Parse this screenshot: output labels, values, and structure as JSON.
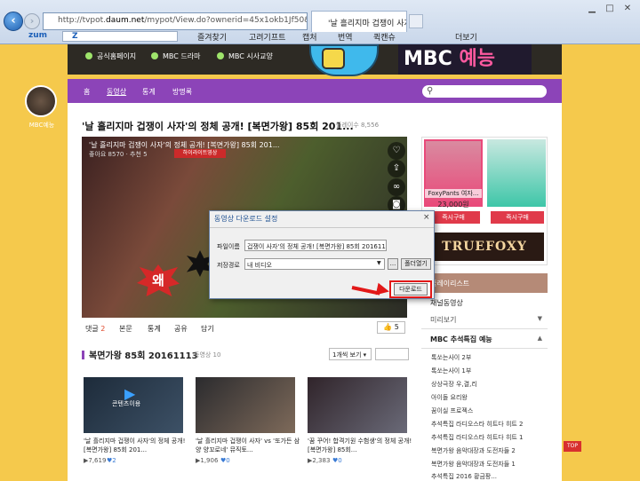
{
  "browser": {
    "address_pre": "http://tvpot.",
    "address_domain": "daum.net",
    "address_post": "/mypot/View.do?ownerid=45x1okb1Jf50&playlistid=6866398",
    "tab_title": "'날 흘리지마 겁쟁이 사자'",
    "toolbar": {
      "zum": "zum",
      "z": "Z",
      "bookmarks": "즐겨찾기",
      "korea_tools": "고려기프트",
      "capture": "캡처",
      "translate": "번역",
      "clean": "퀵캔슈",
      "more": "더보기"
    },
    "window_controls": {
      "min": "▁",
      "max": "□",
      "close": "✕"
    }
  },
  "page": {
    "channel_label": "MBC예능",
    "banner_items": [
      "공식홈페이지",
      "MBC 드라마",
      "MBC 시사교양"
    ],
    "banner_logo_main": "MBC",
    "banner_logo_sub": "예능",
    "nav": [
      "홈",
      "동영상",
      "통계",
      "방명록"
    ],
    "video_title": "'날 흘리지마 겁쟁이 사자'의 정체 공개! [복면가왕] 85회 201...",
    "view_count": "플레이수 8,556",
    "player": {
      "title": "'날 흘리지마 겁쟁이 사자'의 정체 공개! [복면가왕] 85회 201...",
      "meta": "좋아요 8570  ·  추천 5",
      "badge": "하이라이트영상",
      "wow": "왜"
    },
    "video_tabs": {
      "comment": "댓글",
      "comment_count": "2",
      "info": "본문",
      "stats": "통계",
      "share": "공유",
      "add": "담기"
    },
    "like": "👍 5",
    "section_title": "복면가왕 85회 20161113",
    "section_count": "동영상 10",
    "sort": "1개씩 보기 ▾",
    "thumbs": [
      {
        "caption": "'날 흘리지마 겁쟁이 사자'의 정체 공개! [복면가왕] 85회 201...",
        "plays": "▶7,619",
        "likes": "♥2",
        "overlay": "콘텐츠이용"
      },
      {
        "caption": "'날 흘리지마 겁쟁이 사자' vs '또가든 삼양 양꼬로네' 뮤직토...",
        "plays": "▶1,906",
        "likes": "♥0",
        "overlay": ""
      },
      {
        "caption": "'꿈 꾸어! 합격기원 수험생'의 정체 공개! [복면가왕] 85회...",
        "plays": "▶2,383",
        "likes": "♥0",
        "overlay": ""
      }
    ]
  },
  "dialog": {
    "title": "동영상 다운로드 설정",
    "close": "×",
    "filename_label": "파일이름",
    "filename_value": "겁쟁이 사자'의 정체 공개! [복면가왕] 85회 20161113",
    "path_label": "저장경로",
    "path_value": "내 비디오",
    "dots": "...",
    "open_folder": "폴더열기",
    "download": "다운로드"
  },
  "sidebar": {
    "ad_product": "FoxyPants 여자...",
    "ad_price": "23,000원",
    "ad_buy": "즉시구매",
    "ad_brand": "TRUEFOXY",
    "header": "플레이리스트",
    "rows": [
      "채널동영상",
      "미리보기",
      "MBC 추석특집 예능"
    ],
    "list": [
      "톡쏘는사이 2부",
      "톡쏘는사이 1부",
      "상상극장 우,결,리",
      "아이돌 요리왕",
      "꿈이실 프로젝스",
      "추석특집 라디오스타 히트다 히트 2",
      "추석특집 라디오스타 히트다 히트 1",
      "복면가왕 음악대장과 도전자들 2",
      "복면가왕 음악대장과 도전자들 1",
      "추석특집 2016 황금팡..."
    ],
    "top": "TOP"
  },
  "colors": {
    "accent": "#8c44b8",
    "highlight": "#e21818",
    "background": "#f5c94c"
  }
}
